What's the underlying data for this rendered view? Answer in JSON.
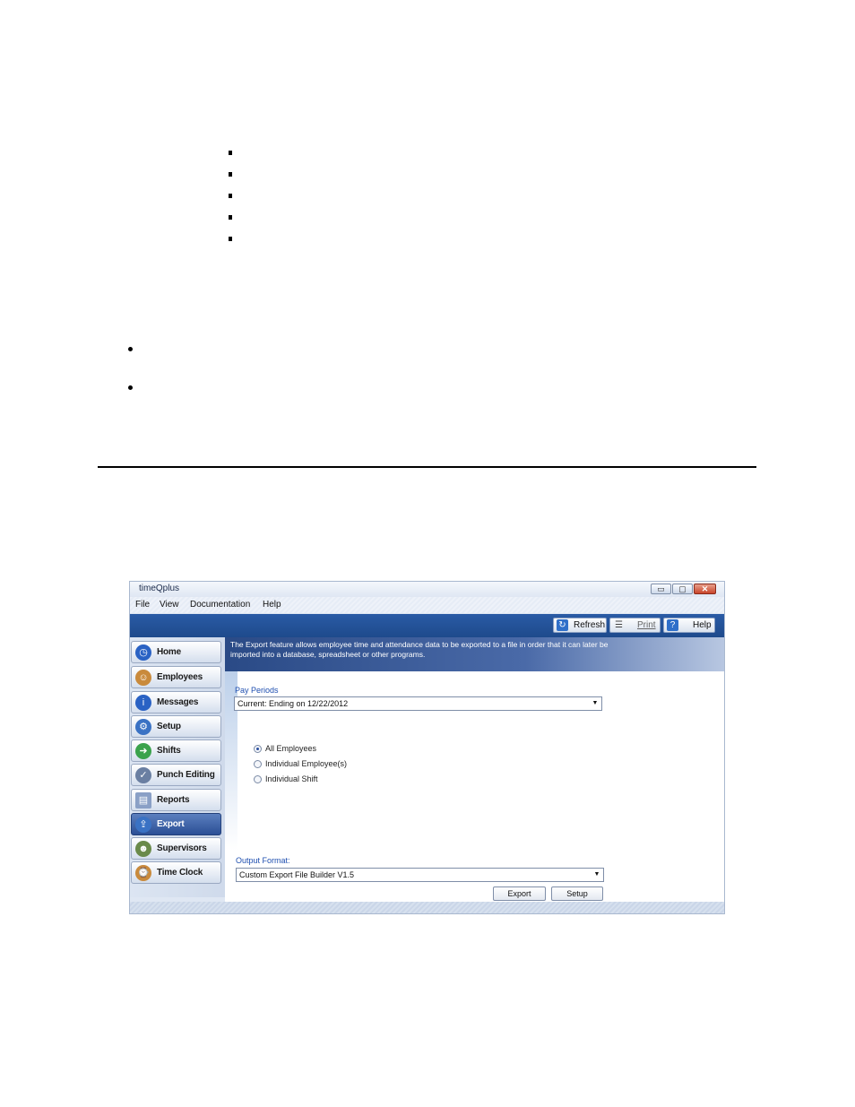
{
  "window": {
    "title": "timeQplus"
  },
  "window_controls": {
    "minimize": "▭",
    "maximize": "▢",
    "close": "✕"
  },
  "menu": [
    "File",
    "View",
    "Documentation",
    "Help"
  ],
  "toolbar": {
    "refresh": "Refresh",
    "print": "Print",
    "help": "Help"
  },
  "sidebar": {
    "items": [
      {
        "label": "Home",
        "icon": "clock-icon",
        "color": "#2a62c4"
      },
      {
        "label": "Employees",
        "icon": "person-icon",
        "color": "#c98a3c"
      },
      {
        "label": "Messages",
        "icon": "info-icon",
        "color": "#2a62c4"
      },
      {
        "label": "Setup",
        "icon": "gear-icon",
        "color": "#3a72c4"
      },
      {
        "label": "Shifts",
        "icon": "shift-icon",
        "color": "#3aa24c"
      },
      {
        "label": "Punch Editing",
        "icon": "check-icon",
        "color": "#6a7fa2"
      },
      {
        "label": "Reports",
        "icon": "document-icon",
        "color": "#8aa0c6"
      },
      {
        "label": "Export",
        "icon": "export-icon",
        "color": "#3a72c4"
      },
      {
        "label": "Supervisors",
        "icon": "group-icon",
        "color": "#6a8a4a"
      },
      {
        "label": "Time Clock",
        "icon": "timeclock-icon",
        "color": "#c98a3c"
      }
    ],
    "active": "Export"
  },
  "banner": {
    "text": "The Export feature allows employee time and attendance data to be exported to a file in order that it can later be imported into a database, spreadsheet or other programs."
  },
  "pay_periods": {
    "label": "Pay Periods",
    "value": "Current:  Ending on 12/22/2012"
  },
  "selection": {
    "options": [
      "All Employees",
      "Individual Employee(s)",
      "Individual Shift"
    ],
    "selected": "All Employees"
  },
  "output_format": {
    "label": "Output Format:",
    "value": "Custom Export File Builder V1.5"
  },
  "buttons": {
    "export": "Export",
    "setup": "Setup"
  }
}
